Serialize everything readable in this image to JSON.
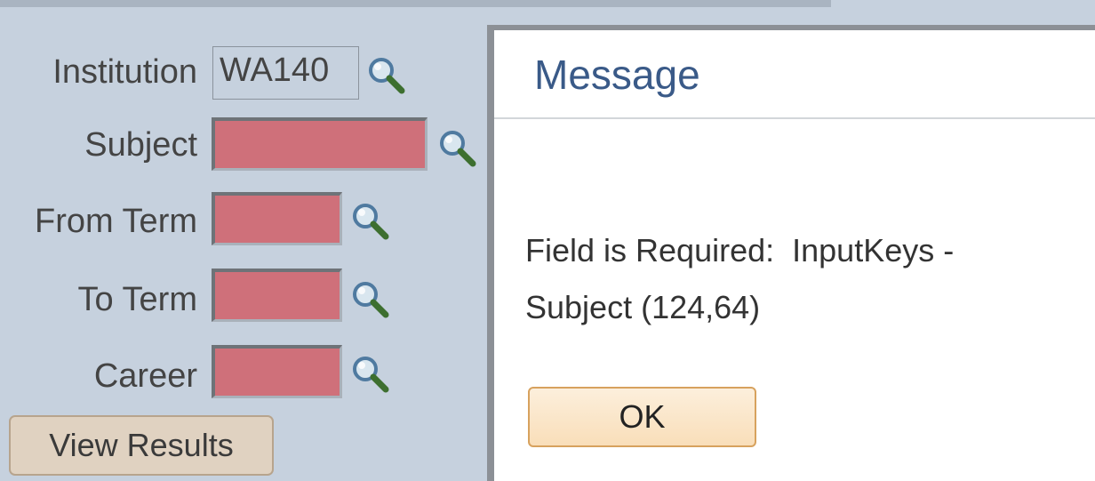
{
  "form": {
    "fields": [
      {
        "label": "Institution",
        "value": "WA140",
        "required_error": false
      },
      {
        "label": "Subject",
        "value": "",
        "required_error": true
      },
      {
        "label": "From Term",
        "value": "",
        "required_error": true
      },
      {
        "label": "To Term",
        "value": "",
        "required_error": true
      },
      {
        "label": "Career",
        "value": "",
        "required_error": true
      }
    ],
    "view_results_label": "View Results",
    "lookup_icon": "magnifying-glass-icon"
  },
  "dialog": {
    "title": "Message",
    "message": "Field is Required:  InputKeys -\nSubject (124,64)",
    "ok_label": "OK"
  },
  "colors": {
    "page_bg": "#c6d1de",
    "required_field": "#cf707a",
    "dialog_title": "#3a5a88",
    "ok_button_border": "#d7a25e"
  }
}
